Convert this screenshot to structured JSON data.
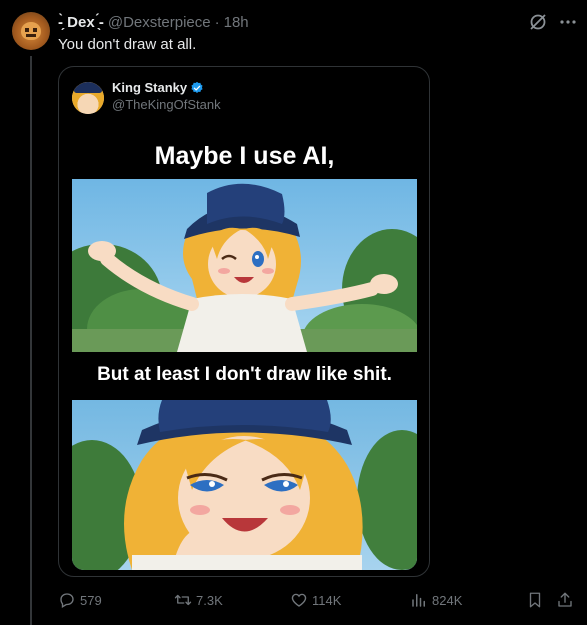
{
  "tweet": {
    "display_name": "-̗̀ Dex ̖́-",
    "handle": "@Dexsterpiece",
    "separator": "·",
    "time": "18h",
    "text": "You don't draw at all."
  },
  "quote": {
    "display_name": "King Stanky",
    "handle": "@TheKingOfStank",
    "meme_top_caption": "Maybe I use AI,",
    "meme_mid_caption": "But at least I don't draw like shit."
  },
  "actions": {
    "replies": "579",
    "reposts": "7.3K",
    "likes": "114K",
    "views": "824K"
  },
  "icons": {
    "reply": "reply-icon",
    "retweet": "retweet-icon",
    "like": "heart-icon",
    "views": "views-icon",
    "bookmark": "bookmark-icon",
    "share": "share-icon",
    "more": "more-icon",
    "grok": "grok-icon",
    "verified": "verified-badge-icon"
  },
  "colors": {
    "background": "#000000",
    "text": "#e7e9ea",
    "muted": "#71767b",
    "border": "#2f3336",
    "verified": "#1d9bf0"
  }
}
